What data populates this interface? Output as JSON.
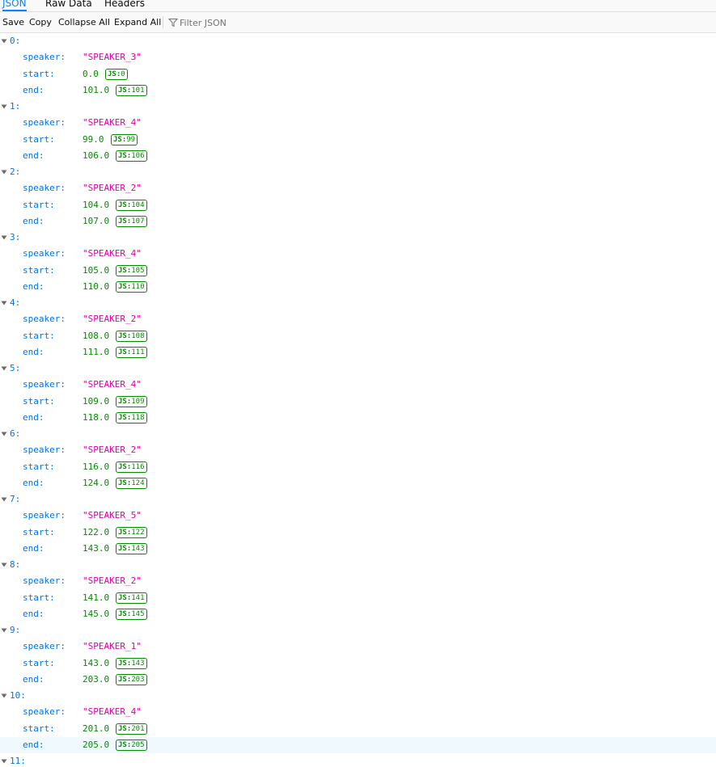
{
  "tabs": [
    {
      "label": "JSON",
      "selected": true
    },
    {
      "label": "Raw Data",
      "selected": false
    },
    {
      "label": "Headers",
      "selected": false
    }
  ],
  "toolbar": {
    "save_label": "Save",
    "copy_label": "Copy",
    "collapse_label": "Collapse All",
    "expand_label": "Expand All",
    "filter_placeholder": "Filter JSON"
  },
  "badge_prefix": "JS:",
  "key_labels": {
    "speaker": "speaker:",
    "start": "start:",
    "end": "end:"
  },
  "items": [
    {
      "index": "0:",
      "speaker": "\"SPEAKER_3\"",
      "start": "0.0",
      "start_js": "0",
      "end": "101.0",
      "end_js": "101"
    },
    {
      "index": "1:",
      "speaker": "\"SPEAKER_4\"",
      "start": "99.0",
      "start_js": "99",
      "end": "106.0",
      "end_js": "106"
    },
    {
      "index": "2:",
      "speaker": "\"SPEAKER_2\"",
      "start": "104.0",
      "start_js": "104",
      "end": "107.0",
      "end_js": "107"
    },
    {
      "index": "3:",
      "speaker": "\"SPEAKER_4\"",
      "start": "105.0",
      "start_js": "105",
      "end": "110.0",
      "end_js": "110"
    },
    {
      "index": "4:",
      "speaker": "\"SPEAKER_2\"",
      "start": "108.0",
      "start_js": "108",
      "end": "111.0",
      "end_js": "111"
    },
    {
      "index": "5:",
      "speaker": "\"SPEAKER_4\"",
      "start": "109.0",
      "start_js": "109",
      "end": "118.0",
      "end_js": "118"
    },
    {
      "index": "6:",
      "speaker": "\"SPEAKER_2\"",
      "start": "116.0",
      "start_js": "116",
      "end": "124.0",
      "end_js": "124"
    },
    {
      "index": "7:",
      "speaker": "\"SPEAKER_5\"",
      "start": "122.0",
      "start_js": "122",
      "end": "143.0",
      "end_js": "143"
    },
    {
      "index": "8:",
      "speaker": "\"SPEAKER_2\"",
      "start": "141.0",
      "start_js": "141",
      "end": "145.0",
      "end_js": "145"
    },
    {
      "index": "9:",
      "speaker": "\"SPEAKER_1\"",
      "start": "143.0",
      "start_js": "143",
      "end": "203.0",
      "end_js": "203"
    },
    {
      "index": "10:",
      "speaker": "\"SPEAKER_4\"",
      "start": "201.0",
      "start_js": "201",
      "end": "205.0",
      "end_js": "205"
    }
  ],
  "partial_item": {
    "index": "11:"
  },
  "colors": {
    "key": "#0074e8",
    "string": "#dd00a9",
    "number": "#058b00",
    "accent": "#0a84ff",
    "row_highlight": "#f0f9fe"
  }
}
